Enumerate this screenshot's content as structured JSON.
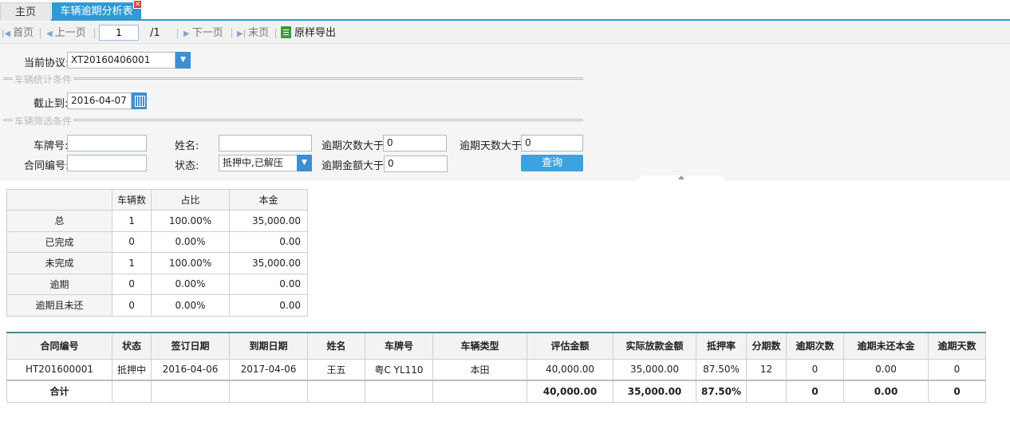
{
  "tabs": {
    "home": "主页",
    "active": "车辆逾期分析表",
    "close": "✕"
  },
  "toolbar": {
    "first": "首页",
    "prev": "上一页",
    "page_value": "1",
    "page_total": "/1",
    "next": "下一页",
    "last": "末页",
    "export": "原样导出"
  },
  "filters": {
    "agreement_label": "当前协议:",
    "agreement_value": "XT20160406001",
    "section_stats": "车辆统计条件",
    "deadline_label": "截止到:",
    "deadline_value": "2016-04-07",
    "section_filter": "车辆筛选条件",
    "plate_label": "车牌号:",
    "plate_value": "",
    "name_label": "姓名:",
    "name_value": "",
    "overdue_times_label": "逾期次数大于",
    "overdue_times_value": "0",
    "overdue_days_label": "逾期天数大于",
    "overdue_days_value": "0",
    "contract_label": "合同编号:",
    "contract_value": "",
    "status_label": "状态:",
    "status_value": "抵押中,已解压",
    "overdue_amount_label": "逾期金额大于",
    "overdue_amount_value": "0",
    "query_button": "查询"
  },
  "stats": {
    "headers": [
      "",
      "车辆数",
      "占比",
      "本金"
    ],
    "rows": [
      [
        "总",
        "1",
        "100.00%",
        "35,000.00"
      ],
      [
        "已完成",
        "0",
        "0.00%",
        "0.00"
      ],
      [
        "未完成",
        "1",
        "100.00%",
        "35,000.00"
      ],
      [
        "逾期",
        "0",
        "0.00%",
        "0.00"
      ],
      [
        "逾期且未还",
        "0",
        "0.00%",
        "0.00"
      ]
    ]
  },
  "detail": {
    "headers": [
      "合同编号",
      "状态",
      "签订日期",
      "到期日期",
      "姓名",
      "车牌号",
      "车辆类型",
      "评估金额",
      "实际放款金额",
      "抵押率",
      "分期数",
      "逾期次数",
      "逾期未还本金",
      "逾期天数"
    ],
    "rows": [
      [
        "HT201600001",
        "抵押中",
        "2016-04-06",
        "2017-04-06",
        "王五",
        "粤C YL110",
        "本田",
        "40,000.00",
        "35,000.00",
        "87.50%",
        "12",
        "0",
        "0.00",
        "0"
      ]
    ],
    "total": [
      "合计",
      "",
      "",
      "",
      "",
      "",
      "",
      "40,000.00",
      "35,000.00",
      "87.50%",
      "",
      "0",
      "0.00",
      "0"
    ]
  }
}
